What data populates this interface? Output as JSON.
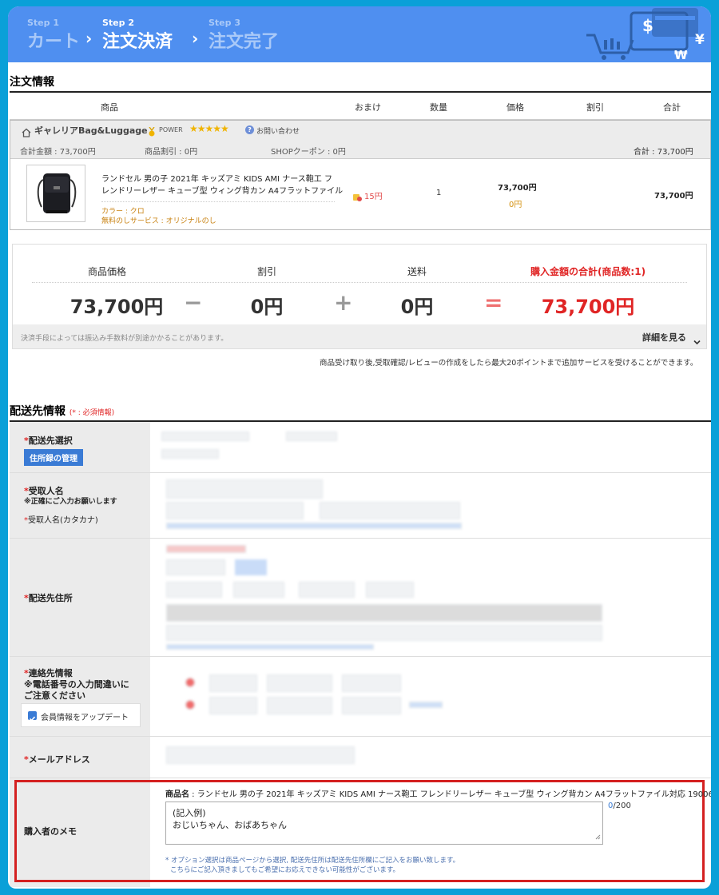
{
  "steps": [
    {
      "label": "Step 1",
      "name": "カート"
    },
    {
      "label": "Step 2",
      "name": "注文決済"
    },
    {
      "label": "Step 3",
      "name": "注文完了"
    }
  ],
  "step_arrow": "›",
  "header_currency": [
    "$",
    "¥",
    "₩"
  ],
  "order": {
    "title": "注文情報",
    "columns": [
      "商品",
      "おまけ",
      "数量",
      "価格",
      "割引",
      "合計"
    ],
    "shop": {
      "name": "ギャレリアBag&Luggage",
      "power": "POWER",
      "stars": "★★★★★",
      "contact": "お問い合わせ",
      "total": "合計金額 : 73,700円",
      "item_discount": "商品割引 : 0円",
      "coupon": "SHOPクーポン : 0円",
      "grand": "合計 : 73,700円"
    },
    "product": {
      "title_line1": "ランドセル 男の子 2021年 キッズアミ KIDS AMI ナース鞄工 フ",
      "title_line2": "レンドリーレザー キューブ型 ウィング背カン A4フラットファイル",
      "color": "カラー : クロ",
      "service": "無料のしサービス : オリジナルのし",
      "bonus": "15円",
      "qty": "1",
      "price": "73,700円",
      "price_discount": "0円",
      "total": "73,700円"
    }
  },
  "summary": {
    "labels": [
      "商品価格",
      "割引",
      "送料",
      "購入金額の合計(商品数:1)"
    ],
    "values": [
      "73,700円",
      "0円",
      "0円",
      "73,700円"
    ],
    "ops": [
      "−",
      "+",
      "="
    ],
    "note": "決済手段によっては振込み手数料が別途かかることがあります。",
    "details": "詳細を見る"
  },
  "points_note": "商品受け取り後,受取確認/レビューの作成をしたら最大20ポイントまで追加サービスを受けることができます。",
  "delivery": {
    "title": "配送先情報",
    "required": "(* : 必須情報)",
    "rows": {
      "select": "配送先選択",
      "address_book": "住所録の管理",
      "recipient": "受取人名",
      "recipient_note": "※正確にご入力お願いします",
      "recipient_kana": "受取人名(カタカナ)",
      "address": "配送先住所",
      "contact": "連絡先情報",
      "contact_note1": "※電話番号の入力間違いに",
      "contact_note2": "ご注意ください",
      "update_member": "会員情報をアップデート",
      "email": "メールアドレス",
      "memo": "購入者のメモ"
    }
  },
  "memo": {
    "product_label": "商品名",
    "product_name": " : ランドセル 男の子 2021年 キッズアミ KIDS AMI ナース鞄工 フレンドリーレザー キューブ型 ウィング背カン A4フラットファイル対応 19006",
    "example_line1": "(記入例)",
    "example_line2": "おじいちゃん、おばあちゃん",
    "count": "0",
    "max": "/200",
    "note1": "* オプション選択は商品ページから選択, 配送先住所は配送先住所欄にご記入をお願い致します。",
    "note2": "こちらにご記入頂きましてもご希望にお応えできない可能性がございます。"
  }
}
